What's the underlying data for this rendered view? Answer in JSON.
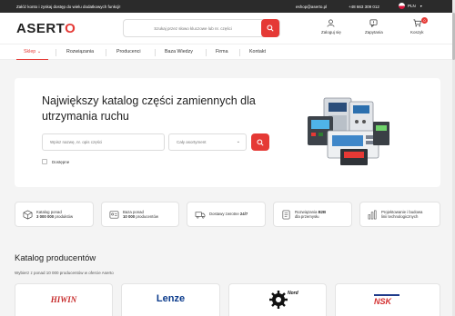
{
  "topbar": {
    "promo": "Załóż konto i zyskaj dostęp do wielu dodatkowych funkcji!",
    "email": "eshop@aserto.pl",
    "phone": "+48 663 309 012",
    "language": "PLN"
  },
  "header": {
    "logo_main": "ASERT",
    "logo_accent": "O",
    "search_placeholder": "Szukaj przez słowo kluczowe lub nr. części",
    "login_label": "Zaloguj się",
    "ask_label": "Zapytania",
    "cart_label": "Koszyk",
    "cart_count": "0"
  },
  "nav": {
    "items": [
      {
        "label": "Sklep"
      },
      {
        "label": "Rozwiązania"
      },
      {
        "label": "Producenci"
      },
      {
        "label": "Baza Wiedzy"
      },
      {
        "label": "Firma"
      },
      {
        "label": "Kontakt"
      }
    ]
  },
  "hero": {
    "title": "Największy katalog części zamiennych dla utrzymania ruchu",
    "search_placeholder": "Wpisz nazwę, nr. opis części",
    "select_value": "Cały asortyment",
    "checkbox_label": "Dostępne"
  },
  "features": [
    {
      "line1": "Katalog ponad",
      "bold": "3 000 000",
      "line2": " produktów"
    },
    {
      "line1": "Baza ponad",
      "bold": "10 000",
      "line2": " producentów"
    },
    {
      "line1": "Dostawy zwrotne ",
      "bold": "24/7",
      "line2": ""
    },
    {
      "line1": "Rozwiązania ",
      "bold": "B2B",
      "line2": "dla przemysłu"
    },
    {
      "line1": "Projektowanie i budowa",
      "bold": "",
      "line2": "linii technologicznych"
    }
  ],
  "catalog": {
    "title": "Katalog producentów",
    "subtitle": "Wybierz z ponad 10 000 producentów w ofercie Aserto",
    "brands": [
      "HIWIN",
      "Lenze",
      "Nord",
      "NSK"
    ]
  },
  "colors": {
    "accent": "#e53935",
    "topbar": "#2b2b2b"
  }
}
